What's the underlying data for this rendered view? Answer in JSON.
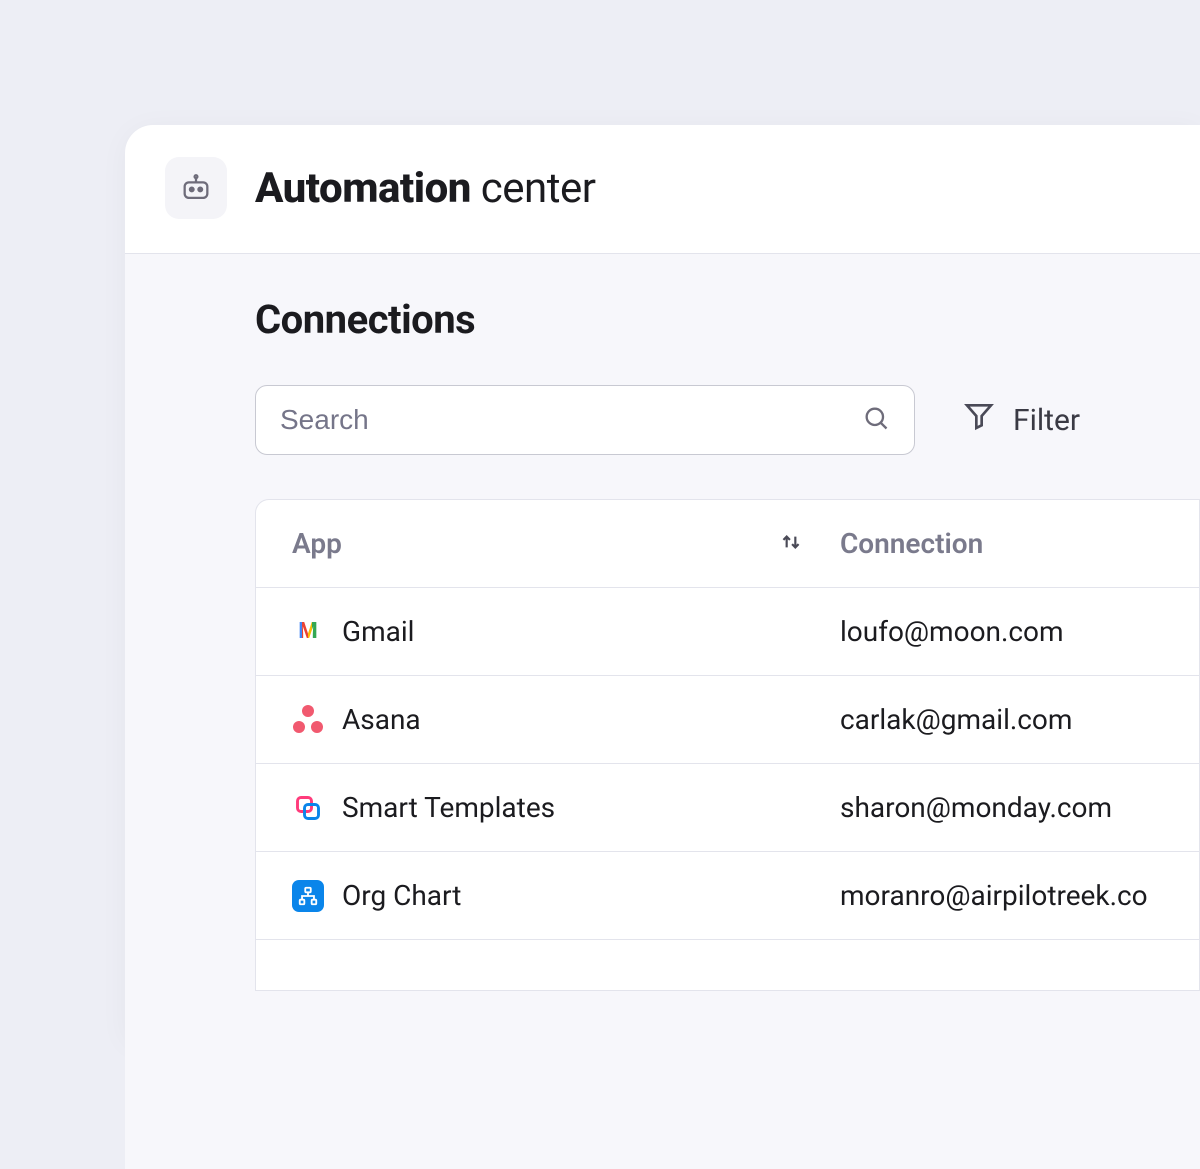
{
  "header": {
    "title_strong": "Automation",
    "title_light": " center"
  },
  "section": {
    "title": "Connections"
  },
  "search": {
    "placeholder": "Search"
  },
  "filter": {
    "label": "Filter"
  },
  "table": {
    "columns": {
      "app": "App",
      "connection": "Connection"
    },
    "rows": [
      {
        "icon": "gmail",
        "app": "Gmail",
        "connection": "loufo@moon.com"
      },
      {
        "icon": "asana",
        "app": "Asana",
        "connection": "carlak@gmail.com"
      },
      {
        "icon": "smart-templates",
        "app": "Smart Templates",
        "connection": "sharon@monday.com"
      },
      {
        "icon": "org-chart",
        "app": "Org Chart",
        "connection": "moranro@airpilotreek.co"
      }
    ]
  }
}
